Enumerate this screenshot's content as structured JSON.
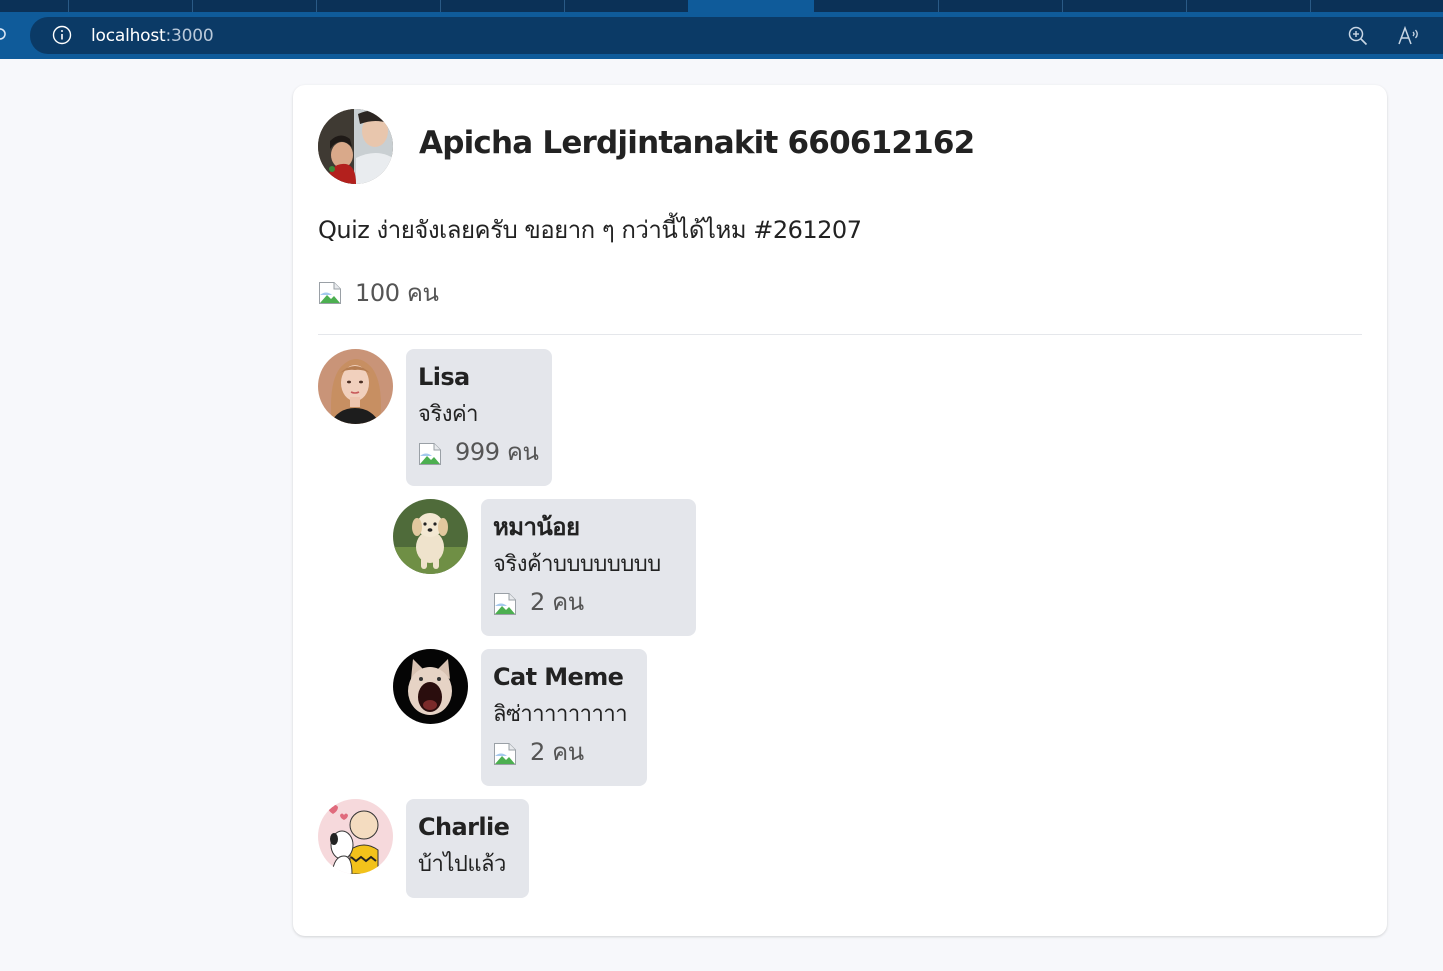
{
  "browser": {
    "url_host": "localhost",
    "url_port": ":3000",
    "icons": [
      "reload-icon",
      "info-icon",
      "zoom-icon",
      "read-aloud-icon"
    ]
  },
  "post": {
    "author": "Apicha Lerdjintanakit 660612162",
    "text": "Quiz ง่ายจังเลยครับ ขอยาก ๆ กว่านี้ได้ไหม #261207",
    "likes": "100 คน"
  },
  "comments": [
    {
      "name": "Lisa",
      "text": "จริงค่า",
      "likes": "999 คน",
      "replies": [
        {
          "name": "หมาน้อย",
          "text": "จริงค้าบบบบบบบบ",
          "likes": "2 คน"
        },
        {
          "name": "Cat Meme",
          "text": "ลิซ่าาาาาาาาา",
          "likes": "2 คน"
        }
      ]
    },
    {
      "name": "Charlie",
      "text": "บ้าไปแล้ว"
    }
  ],
  "colors": {
    "chrome_dark": "#0b3157",
    "chrome_active": "#0f5b9a",
    "bubble": "#e4e6eb",
    "page_bg": "#f7f8fb"
  }
}
